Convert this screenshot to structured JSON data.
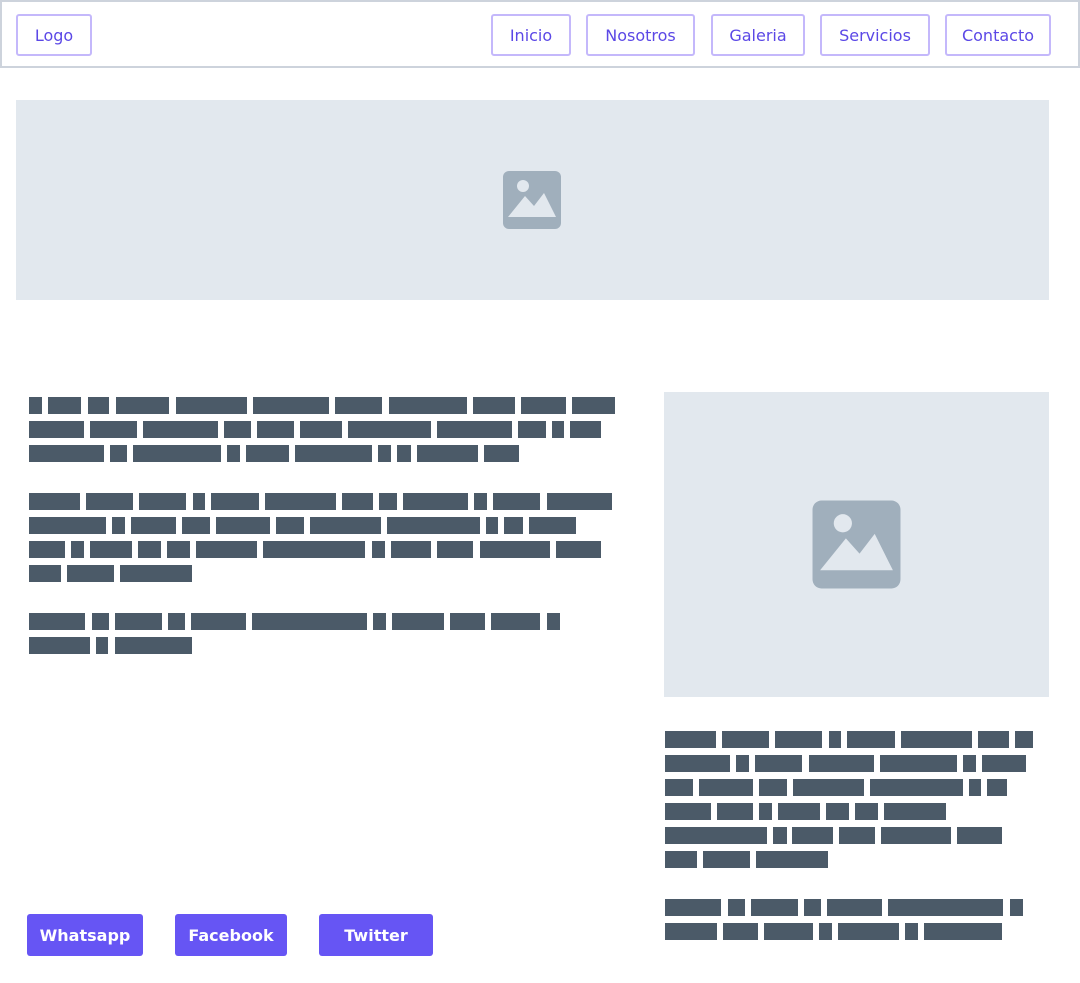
{
  "nav": {
    "logo": "Logo",
    "items": [
      "Inicio",
      "Nosotros",
      "Galeria",
      "Servicios",
      "Contacto"
    ]
  },
  "social": {
    "whatsapp": "Whatsapp",
    "facebook": "Facebook",
    "twitter": "Twitter"
  },
  "icons": {
    "banner": "image-placeholder-icon",
    "side": "image-placeholder-icon"
  },
  "colors": {
    "accent": "#6655f4",
    "nav_text": "#5b48e6",
    "nav_border": "#c4b8fb",
    "placeholder_bg": "#e2e8ee",
    "placeholder_icon": "#a0afbc",
    "text_block": "#4b5a68"
  }
}
